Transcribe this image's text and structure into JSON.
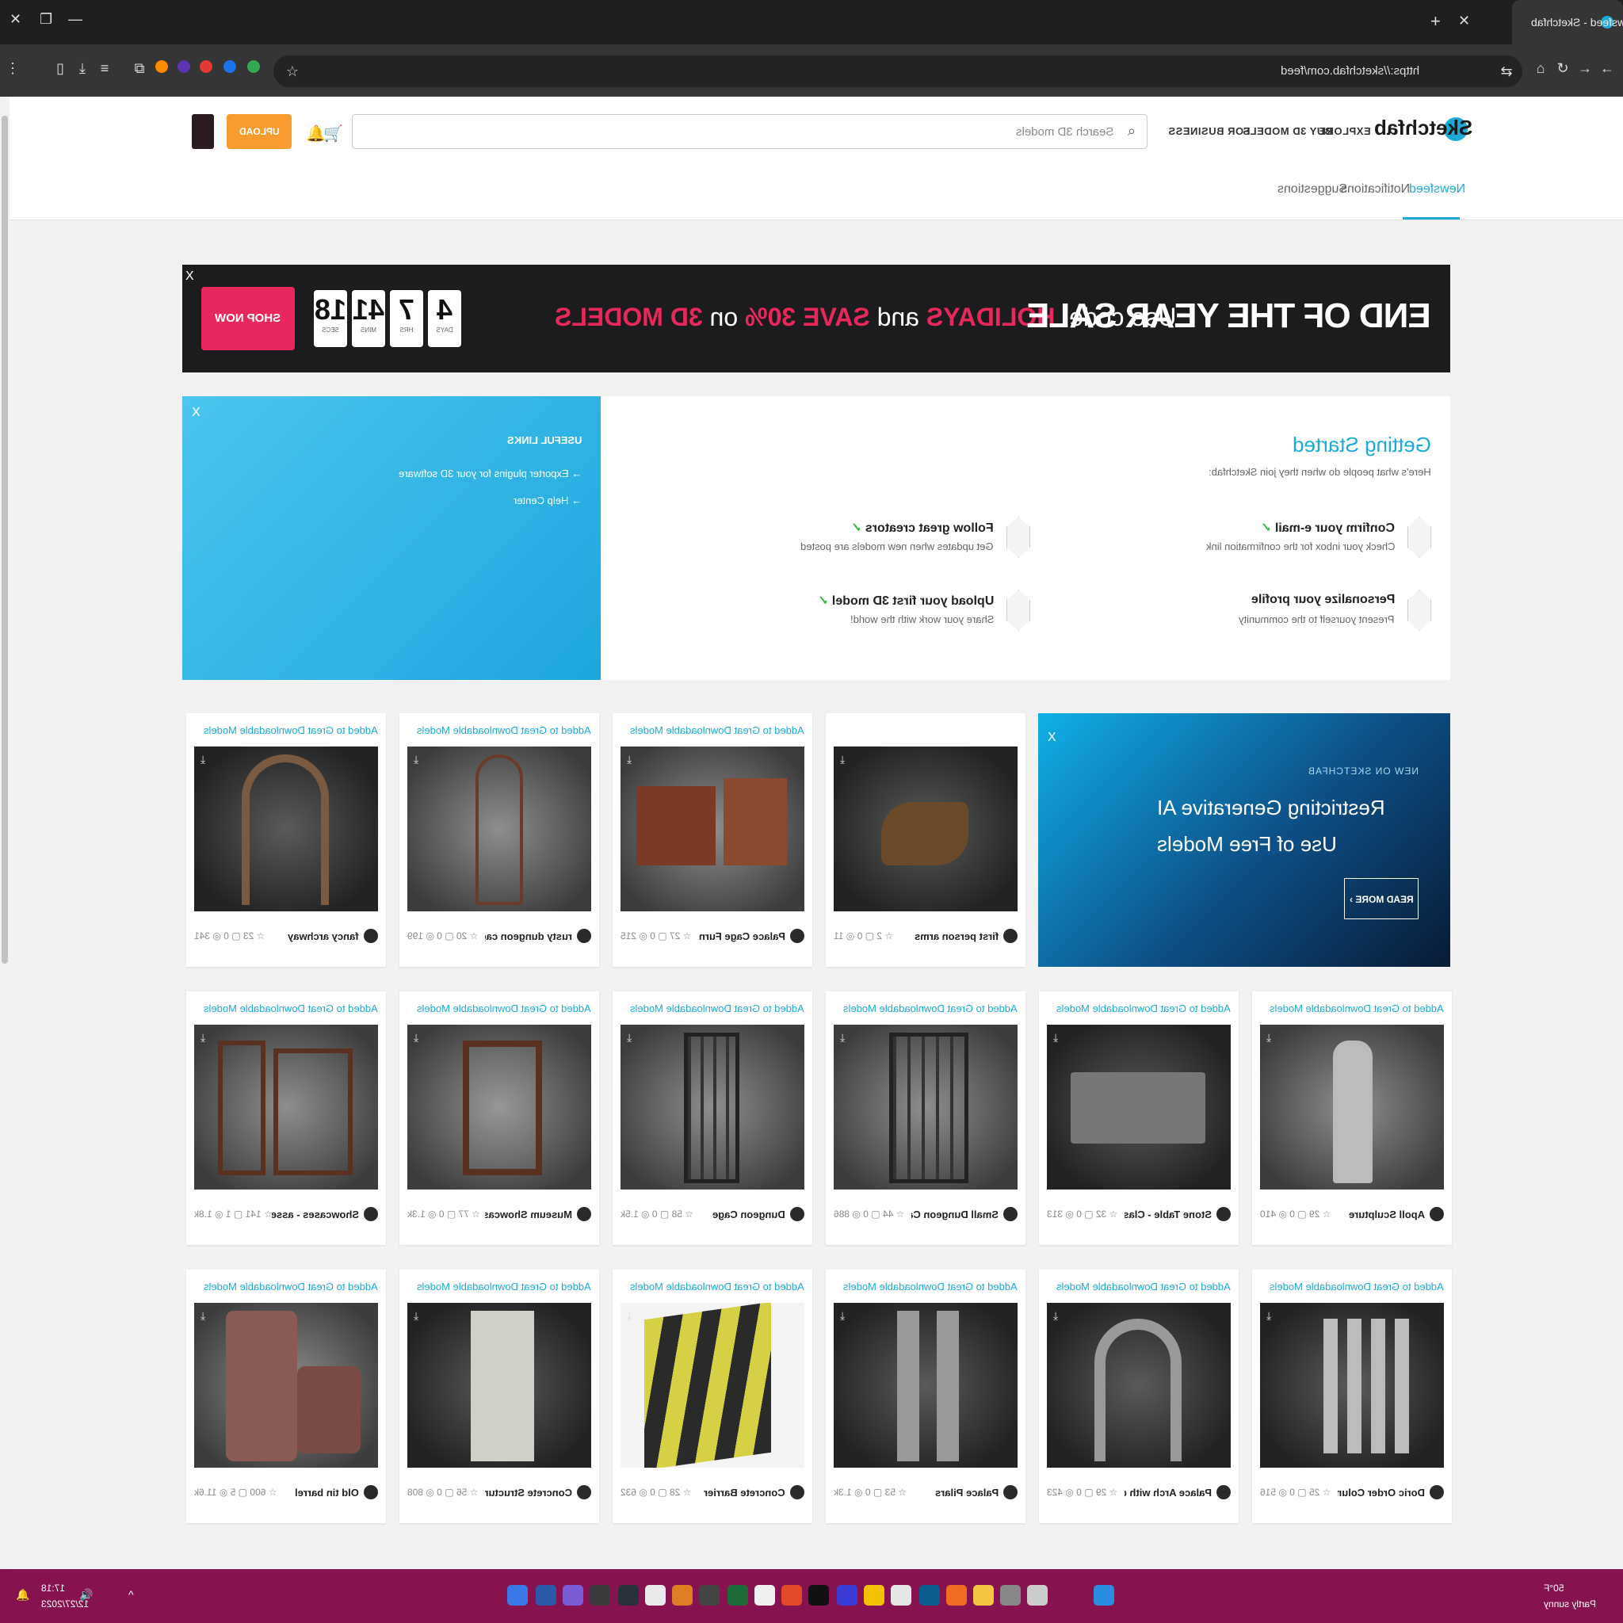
{
  "browser": {
    "tab_title": "Newsfeed - Sketchfab",
    "url": "https://sketchfab.com/feed",
    "window_controls": [
      "—",
      "❐",
      "✕"
    ],
    "new_tab": "+",
    "tab_close": "✕"
  },
  "header": {
    "logo": "Sketchfab",
    "nav": [
      "EXPLORE",
      "BUY 3D MODELS",
      "FOR BUSINESS"
    ],
    "search_placeholder": "Search 3D models",
    "upload_label": "UPLOAD",
    "subtabs": [
      "Newsfeed",
      "Notifications",
      "Suggestions"
    ],
    "active_subtab": "Newsfeed"
  },
  "promo": {
    "title": "END OF THE YEAR SALE",
    "use_code": "Use code:",
    "code": "HOLIDAYS",
    "and": "and",
    "save": "SAVE 30%",
    "on": "on",
    "models": "3D MODELS",
    "countdown": [
      {
        "value": "4",
        "label": "DAYS"
      },
      {
        "value": "7",
        "label": "HRS"
      },
      {
        "value": "41",
        "label": "MINS"
      },
      {
        "value": "18",
        "label": "SECS"
      }
    ],
    "shop_label": "SHOP NOW",
    "close": "X"
  },
  "getting_started": {
    "title": "Getting Started",
    "subtitle": "Here's what people do when they join Sketchfab:",
    "steps": [
      {
        "title": "Confirm your e-mail",
        "desc": "Check your inbox for the confirmation link",
        "done": "✓"
      },
      {
        "title": "Follow great creators",
        "desc": "Get updates when new models are posted",
        "done": "✓"
      },
      {
        "title": "Personalize your profile",
        "desc": "Present yourself to the community",
        "done": ""
      },
      {
        "title": "Upload your first 3D model",
        "desc": "Share your work with the world!",
        "done": "✓"
      }
    ],
    "useful_links_title": "USEFUL LINKS",
    "links": [
      "→ Exporter plugins for your 3D software",
      "→ Help Center"
    ],
    "close": "X"
  },
  "ai_card": {
    "kicker": "NEW ON SKETCHFAB",
    "title": "Restricting Generative AI Use of Free Models",
    "button": "READ MORE ›",
    "close": "X"
  },
  "added_prefix": "Added to",
  "collection": "Great Downloadable Models",
  "cards": [
    {
      "title": "first person arms",
      "views": "11",
      "comments": "0",
      "likes": "2",
      "added": false
    },
    {
      "title": "Palace Cage Furniture...",
      "views": "215",
      "comments": "0",
      "likes": "27",
      "added": true
    },
    {
      "title": "rusty dungeon cage",
      "views": "199",
      "comments": "0",
      "likes": "20",
      "added": true
    },
    {
      "title": "fancy archway",
      "views": "341",
      "comments": "0",
      "likes": "23",
      "added": true
    },
    {
      "title": "Apoll Sculpture",
      "views": "410",
      "comments": "0",
      "likes": "29",
      "added": true
    },
    {
      "title": "Stone Table - Classical...",
      "views": "313",
      "comments": "0",
      "likes": "32",
      "added": true
    },
    {
      "title": "Small Dungeon Cage",
      "views": "886",
      "comments": "0",
      "likes": "44",
      "added": true
    },
    {
      "title": "Dungeon Cage",
      "views": "1.5k",
      "comments": "0",
      "likes": "58",
      "added": true
    },
    {
      "title": "Museum Showcase - ...",
      "views": "1.3k",
      "comments": "0",
      "likes": "77",
      "added": true
    },
    {
      "title": "Showcases - asset p...",
      "views": "1.8k",
      "comments": "1",
      "likes": "141",
      "added": true
    },
    {
      "title": "Doric Order Columns ...",
      "views": "516",
      "comments": "0",
      "likes": "25",
      "added": true
    },
    {
      "title": "Palace Arch with deco...",
      "views": "423",
      "comments": "0",
      "likes": "29",
      "added": true
    },
    {
      "title": "Palace Pilars",
      "views": "1.3k",
      "comments": "0",
      "likes": "53",
      "added": true
    },
    {
      "title": "Concrete Barrier",
      "views": "632",
      "comments": "0",
      "likes": "28",
      "added": true
    },
    {
      "title": "Concrete Structure",
      "views": "808",
      "comments": "0",
      "likes": "56",
      "added": true
    },
    {
      "title": "Old tin barrel",
      "views": "11.6k",
      "comments": "5",
      "likes": "600",
      "added": true
    }
  ],
  "taskbar": {
    "time": "17:18",
    "date": "12/27/2023",
    "temp": "50°F",
    "weather": "Partly sunny"
  },
  "colors": {
    "accent": "#1caad9",
    "upload": "#f79c2c",
    "sale": "#e8285a",
    "taskbar": "#86134f"
  }
}
